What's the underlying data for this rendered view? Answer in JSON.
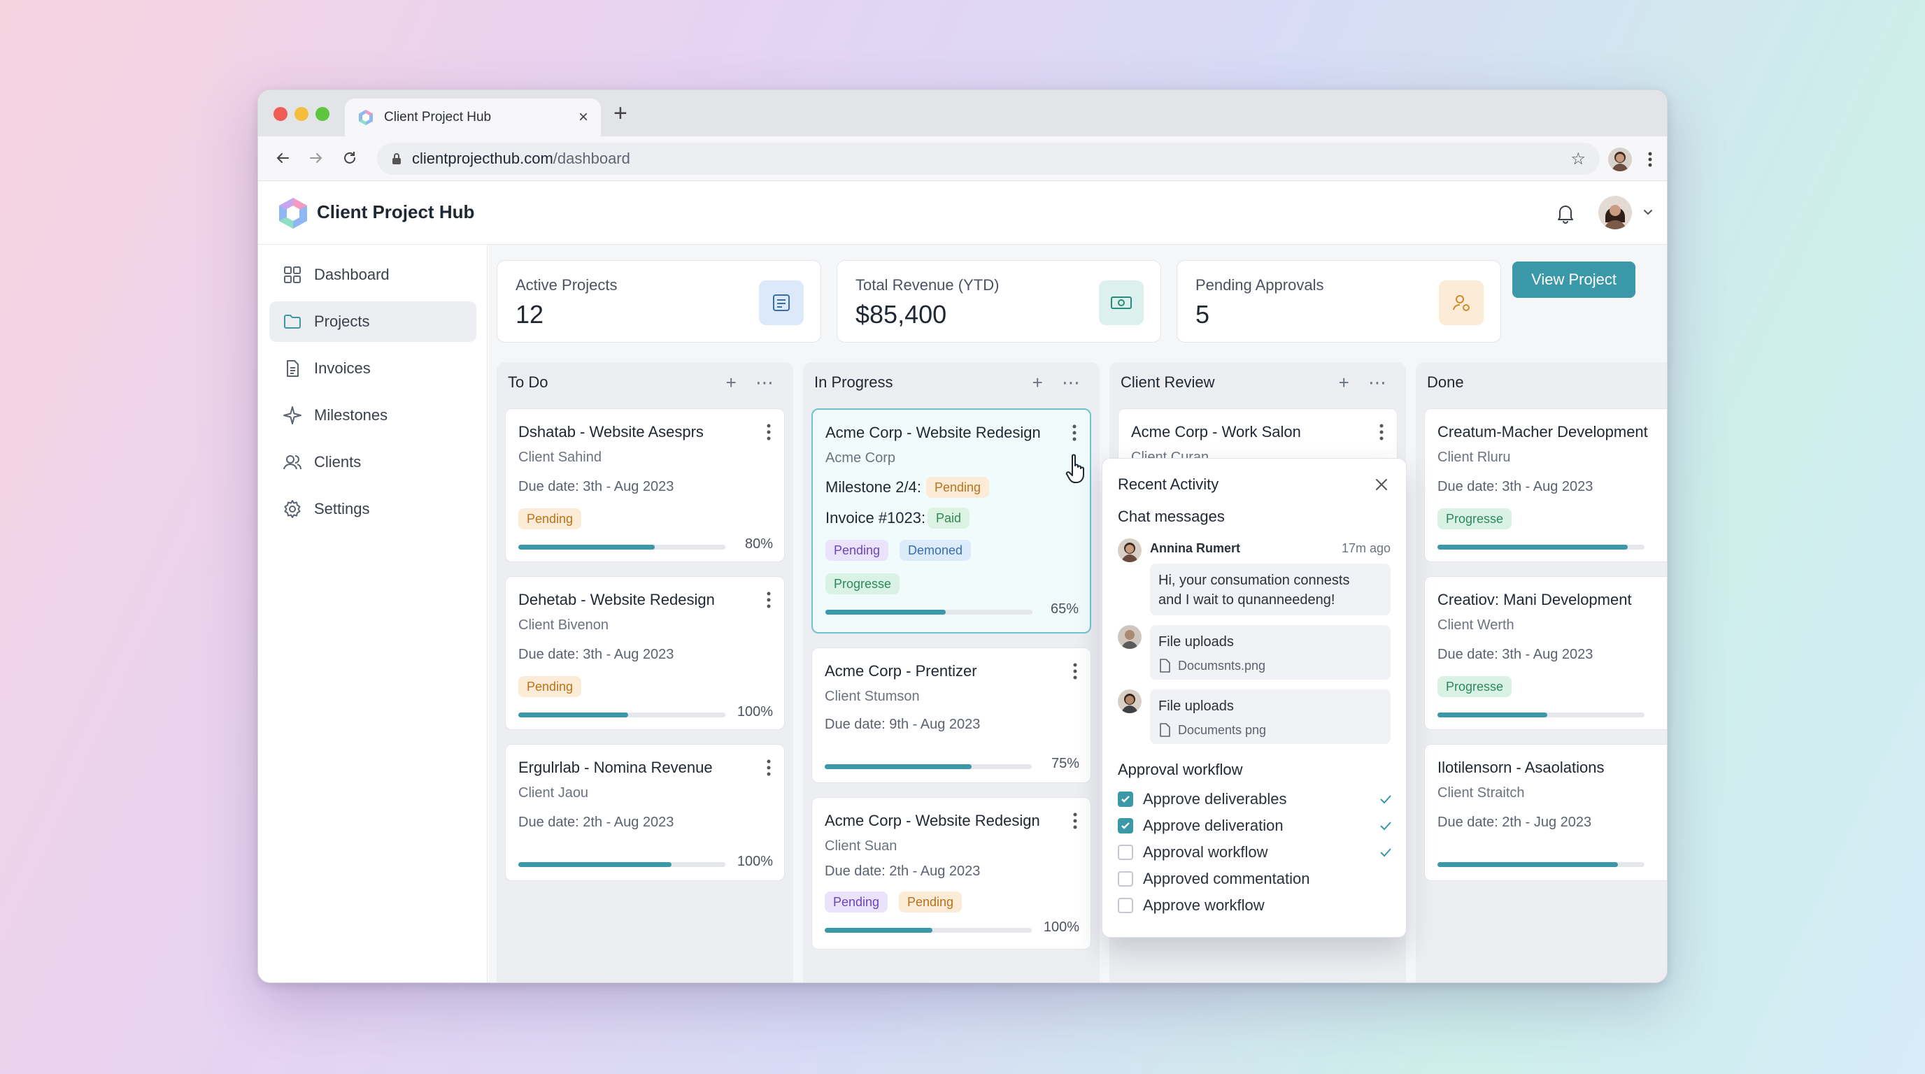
{
  "browser": {
    "tab_title": "Client Project Hub",
    "tab_close": "×",
    "new_tab": "+",
    "url_domain": "clientprojecthub.com",
    "url_path": "/dashboard",
    "bookmark": "☆"
  },
  "app": {
    "title": "Client Project Hub"
  },
  "sidebar": {
    "items": [
      {
        "label": "Dashboard",
        "icon": "grid-icon"
      },
      {
        "label": "Projects",
        "icon": "folder-icon",
        "active": true
      },
      {
        "label": "Invoices",
        "icon": "document-icon"
      },
      {
        "label": "Milestones",
        "icon": "sparkle-icon"
      },
      {
        "label": "Clients",
        "icon": "users-icon"
      },
      {
        "label": "Settings",
        "icon": "gear-icon"
      }
    ]
  },
  "stats": [
    {
      "label": "Active Projects",
      "value": "12",
      "icon": "projects-icon",
      "color": "#dbe9fa"
    },
    {
      "label": "Total Revenue (YTD)",
      "value": "$85,400",
      "icon": "money-icon",
      "color": "#dcf1ee"
    },
    {
      "label": "Pending Approvals",
      "value": "5",
      "icon": "user-pending-icon",
      "color": "#fcebd6"
    }
  ],
  "view_project_button": "View Project",
  "column_actions": "+ ⋯",
  "columns": [
    {
      "title": "To Do",
      "cards": [
        {
          "title": "Dshatab - Website Asesprs",
          "client": "Client Sahind",
          "due": "Due date: 3th - Aug 2023",
          "badge": "Pending",
          "progress": 0.66,
          "pct": "80%"
        },
        {
          "title": "Dehetab - Website Redesign",
          "client": "Client Bivenon",
          "due": "Due date: 3th - Aug 2023",
          "badge": "Pending",
          "progress": 0.53,
          "pct": "100%"
        },
        {
          "title": "Ergulrlab - Nomina Revenue",
          "client": "Client Jaou",
          "due": "Due date: 2th - Aug 2023",
          "progress": 0.74,
          "pct": "100%"
        }
      ]
    },
    {
      "title": "In Progress",
      "cards": [
        {
          "title": "Acme Corp - Website Redesign",
          "client": "Acme Corp",
          "milestone": "Milestone 2/4:",
          "milestone_badge": "Pending",
          "invoice": "Invoice #1023:",
          "invoice_badge": "Paid",
          "badges": [
            "Pending",
            "Demoned"
          ],
          "status": "Progresse",
          "progress": 0.58,
          "pct": "65%"
        },
        {
          "title": "Acme Corp - Prentizer",
          "client": "Client Stumson",
          "due": "Due date: 9th - Aug 2023",
          "progress": 0.71,
          "pct": "75%"
        },
        {
          "title": "Acme Corp - Website Redesign",
          "client": "Client Suan",
          "due": "Due date: 2th - Aug 2023",
          "badges": [
            "Pending",
            "Pending"
          ],
          "progress": 0.52,
          "pct": "100%"
        }
      ]
    },
    {
      "title": "Client Review",
      "cards": [
        {
          "title": "Acme Corp - Work Salon",
          "client": "Client Curan"
        }
      ]
    },
    {
      "title": "Done",
      "cards": [
        {
          "title": "Creatum-Macher Development",
          "client": "Client Rluru",
          "due": "Due date: 3th - Aug 2023",
          "badge": "Progresse",
          "progress": 0.92
        },
        {
          "title": "Creatiov: Mani Development",
          "client": "Client Werth",
          "due": "Due date: 3th - Aug 2023",
          "badge": "Progresse",
          "progress": 0.53
        },
        {
          "title": "Ilotilensorn - Asaolations",
          "client": "Client Straitch",
          "due": "Due date: 2th - Jug 2023",
          "progress": 0.87
        }
      ]
    }
  ],
  "activity": {
    "title": "Recent Activity",
    "chat_heading": "Chat messages",
    "message": {
      "name": "Annina Rumert",
      "time": "17m ago",
      "line1": "Hi, your consumation connests",
      "line2": "and I wait to qunanneedeng!"
    },
    "files": [
      {
        "title": "File uploads",
        "file": "Documsnts.png"
      },
      {
        "title": "File uploads",
        "file": "Documents png"
      }
    ],
    "approval_heading": "Approval workflow",
    "approvals": [
      {
        "label": "Approve deliverables",
        "checked": true,
        "tick": true
      },
      {
        "label": "Approve deliveration",
        "checked": true,
        "tick": true
      },
      {
        "label": "Approval workflow",
        "checked": false,
        "tick": true
      },
      {
        "label": "Approved commentation",
        "checked": false,
        "tick": false
      },
      {
        "label": "Approve workflow",
        "checked": false,
        "tick": false
      }
    ]
  },
  "colors": {
    "accent": "#3a98a8",
    "pending": "#b8731b",
    "paid": "#2f8a4e"
  }
}
